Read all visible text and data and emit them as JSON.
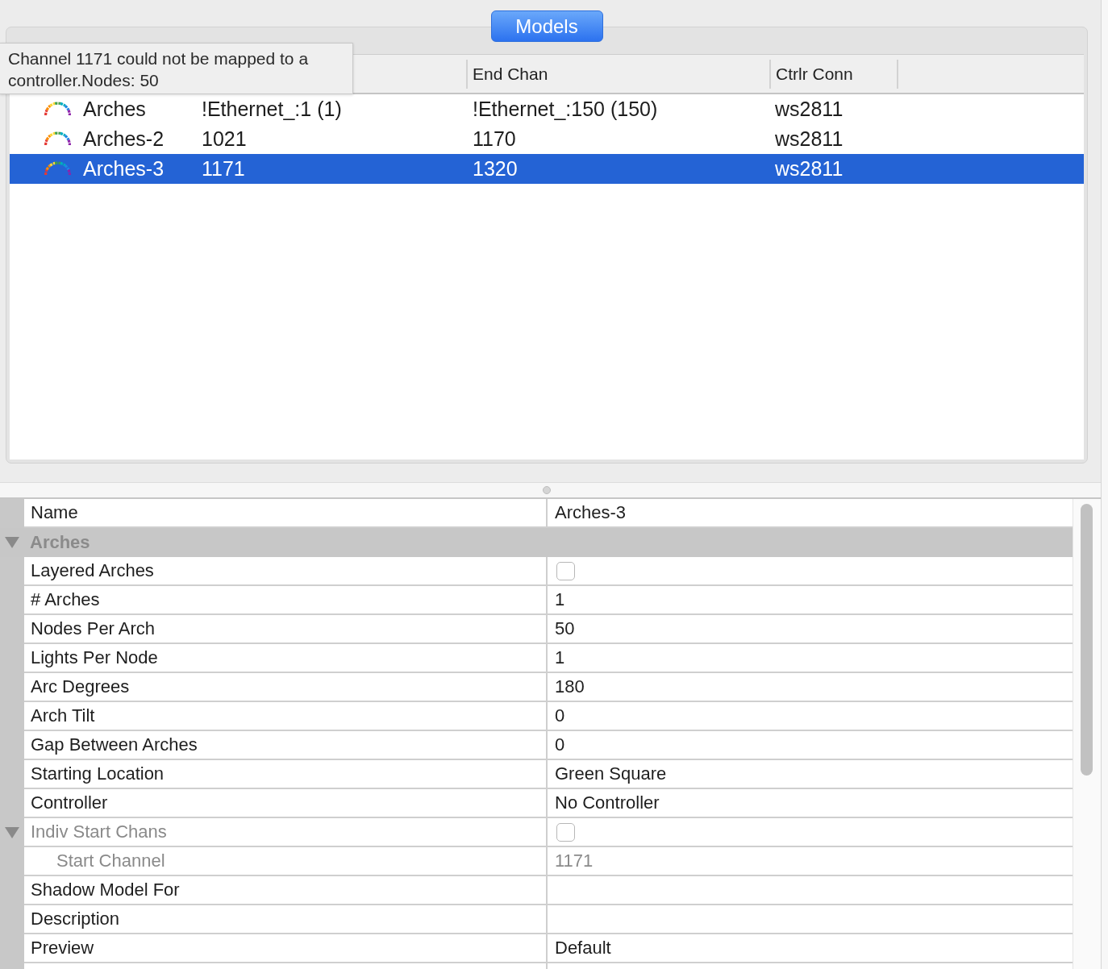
{
  "tab": {
    "label": "Models",
    "selected": true
  },
  "tooltip": {
    "lines": [
      "Channel 1171 could not be mapped to a",
      "controller.Nodes: 50"
    ]
  },
  "models_table": {
    "columns": [
      "End Chan",
      "Ctrlr Conn"
    ],
    "rows": [
      {
        "column_1": "Arches",
        "column_2": "!Ethernet_:1 (1)",
        "end_chan": "!Ethernet_:150 (150)",
        "ctrlr_conn": "ws2811",
        "selected": false
      },
      {
        "column_1": "Arches-2",
        "column_2": "1021",
        "end_chan": "1170",
        "ctrlr_conn": "ws2811",
        "selected": false
      },
      {
        "column_1": "Arches-3",
        "column_2": "1171",
        "end_chan": "1320",
        "ctrlr_conn": "ws2811",
        "selected": true
      }
    ]
  },
  "properties": [
    {
      "kind": "text",
      "label": "Name",
      "value": "Arches-3",
      "disabled": false
    },
    {
      "kind": "category",
      "label": "Arches",
      "expanded": true,
      "children": [
        {
          "kind": "checkbox",
          "label": "Layered Arches",
          "checked": false,
          "disabled": false
        },
        {
          "kind": "text",
          "label": "# Arches",
          "value": "1",
          "disabled": false
        },
        {
          "kind": "text",
          "label": "Nodes Per Arch",
          "value": "50",
          "disabled": false
        },
        {
          "kind": "text",
          "label": "Lights Per Node",
          "value": "1",
          "disabled": false
        },
        {
          "kind": "text",
          "label": "Arc Degrees",
          "value": "180",
          "disabled": false
        },
        {
          "kind": "text",
          "label": "Arch Tilt",
          "value": "0",
          "disabled": false
        },
        {
          "kind": "text",
          "label": "Gap Between Arches",
          "value": "0",
          "disabled": false
        },
        {
          "kind": "text",
          "label": "Starting Location",
          "value": "Green Square",
          "disabled": false
        },
        {
          "kind": "text",
          "label": "Controller",
          "value": "No Controller",
          "disabled": false
        },
        {
          "kind": "checkbox",
          "label": "Indiv Start Chans",
          "checked": false,
          "disabled": true,
          "expanded": true,
          "children": [
            {
              "kind": "text",
              "label": "Start Channel",
              "value": "1171",
              "disabled": true
            }
          ]
        },
        {
          "kind": "text",
          "label": "Shadow Model For",
          "disabled": false
        },
        {
          "kind": "text",
          "label": "Description",
          "disabled": false
        },
        {
          "kind": "text",
          "label": "Preview",
          "value": "Default",
          "disabled": false
        }
      ]
    }
  ]
}
